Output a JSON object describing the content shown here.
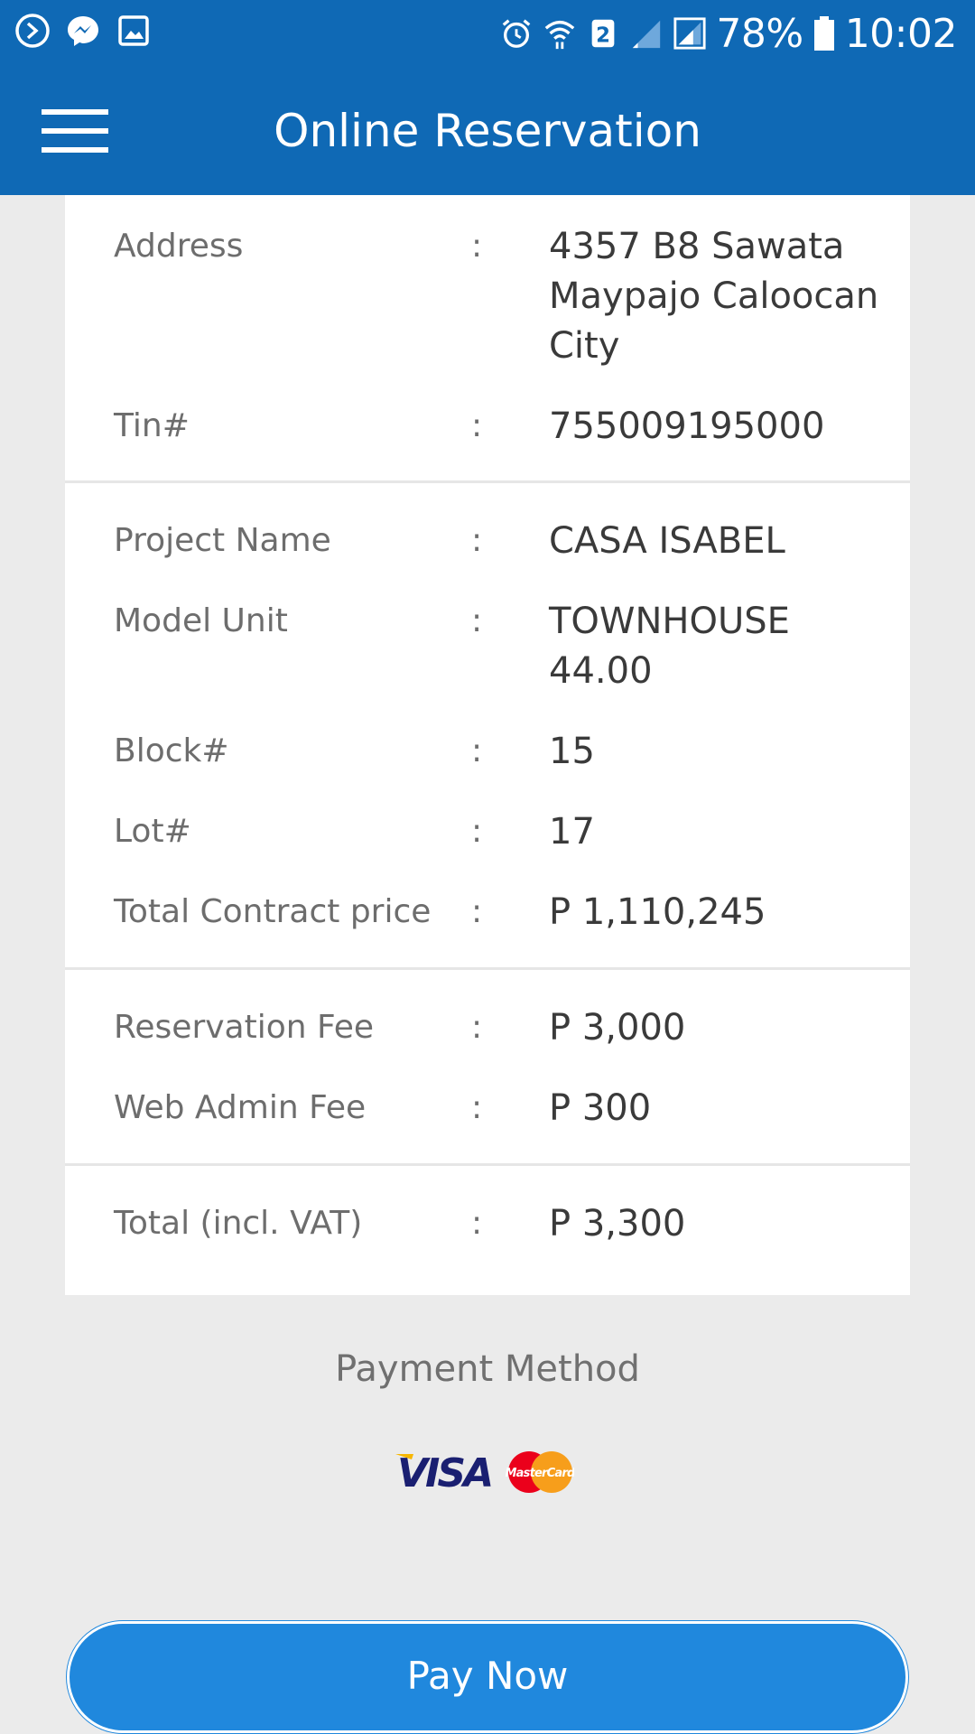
{
  "status_bar": {
    "battery": "78%",
    "sim_slot": "2",
    "time": "10:02",
    "left_icons": [
      "sync-icon",
      "messenger-icon",
      "gallery-icon"
    ],
    "right_icons": [
      "alarm-icon",
      "wifi-icon",
      "sim-icon",
      "signal-icon",
      "signal-icon",
      "battery-icon"
    ]
  },
  "app_bar": {
    "title": "Online Reservation",
    "menu_icon": "hamburger-menu-icon"
  },
  "details": {
    "address": {
      "label": "Address",
      "colon": ":",
      "value": "4357 B8 Sawata Maypajo Caloocan City"
    },
    "tin": {
      "label": "Tin#",
      "colon": ":",
      "value": "755009195000"
    },
    "project_name": {
      "label": "Project Name",
      "colon": ":",
      "value": "CASA ISABEL"
    },
    "model_unit": {
      "label": "Model Unit",
      "colon": ":",
      "value": "TOWNHOUSE 44.00"
    },
    "block": {
      "label": "Block#",
      "colon": ":",
      "value": "15"
    },
    "lot": {
      "label": "Lot#",
      "colon": ":",
      "value": "17"
    },
    "total_contract_price": {
      "label": "Total Contract price",
      "colon": ":",
      "value": "P 1,110,245"
    },
    "reservation_fee": {
      "label": "Reservation Fee",
      "colon": ":",
      "value": "P 3,000"
    },
    "web_admin_fee": {
      "label": "Web Admin Fee",
      "colon": ":",
      "value": "P 300"
    },
    "total": {
      "label": "Total (incl. VAT)",
      "colon": ":",
      "value": "P 3,300"
    }
  },
  "payment": {
    "title": "Payment Method",
    "visa_text": "VISA",
    "mastercard_text": "MasterCard",
    "button_label": "Pay Now"
  },
  "colors": {
    "primary": "#0f69b5",
    "button": "#2088dd",
    "background": "#ebebeb",
    "card": "#ffffff",
    "label_text": "#6d6d6d",
    "value_text": "#3a3a3a"
  }
}
